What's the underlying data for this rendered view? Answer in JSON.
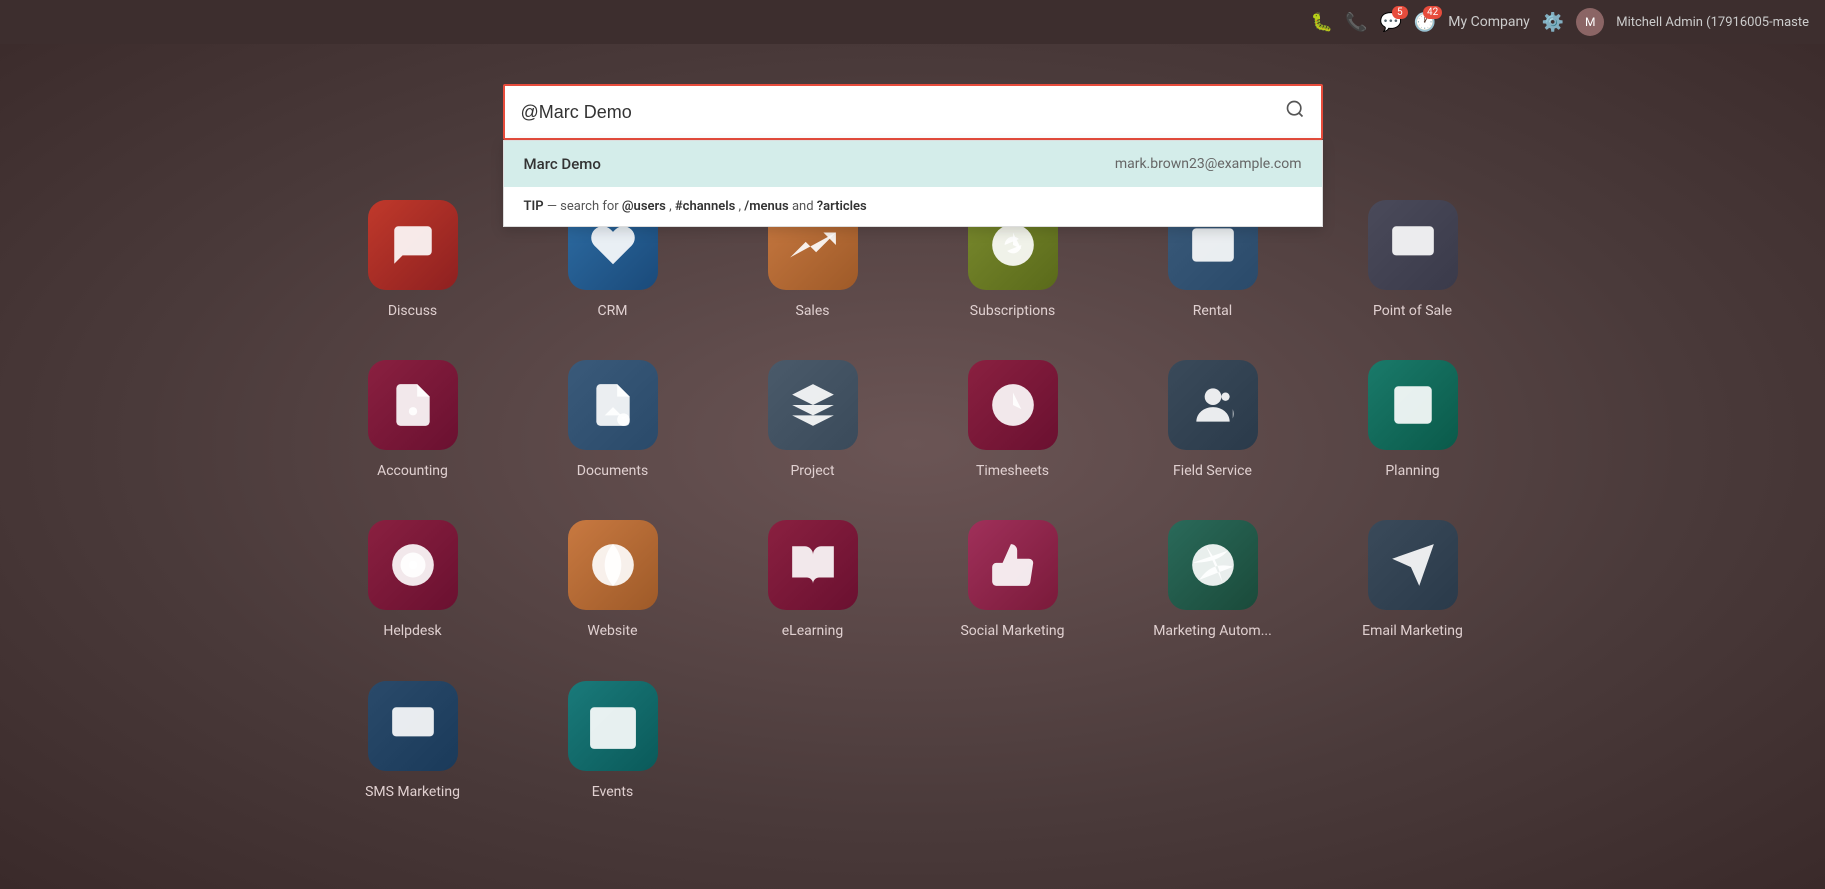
{
  "topbar": {
    "company": "My Company",
    "username": "Mitchell Admin (17916005-maste",
    "chat_badge": "5",
    "activity_badge": "42"
  },
  "search": {
    "value": "@Marc Demo",
    "placeholder": "Search..."
  },
  "dropdown": {
    "result_name": "Marc Demo",
    "result_email": "mark.brown23@example.com",
    "tip_text": " — search for ",
    "tip_users": "@users",
    "tip_channels": "#channels",
    "tip_menus": "/menus",
    "tip_articles": "?articles",
    "tip_label": "TIP",
    "tip_and": " and "
  },
  "apps": [
    {
      "id": "discuss",
      "label": "Discuss",
      "icon_class": "ic-discuss"
    },
    {
      "id": "crm",
      "label": "CRM",
      "icon_class": "ic-crm"
    },
    {
      "id": "sales",
      "label": "Sales",
      "icon_class": "ic-sales"
    },
    {
      "id": "subscriptions",
      "label": "Subscriptions",
      "icon_class": "ic-subscriptions"
    },
    {
      "id": "rental",
      "label": "Rental",
      "icon_class": "ic-rental"
    },
    {
      "id": "pos",
      "label": "Point of Sale",
      "icon_class": "ic-pos"
    },
    {
      "id": "accounting",
      "label": "Accounting",
      "icon_class": "ic-accounting"
    },
    {
      "id": "documents",
      "label": "Documents",
      "icon_class": "ic-documents"
    },
    {
      "id": "project",
      "label": "Project",
      "icon_class": "ic-project"
    },
    {
      "id": "timesheets",
      "label": "Timesheets",
      "icon_class": "ic-timesheets"
    },
    {
      "id": "fieldservice",
      "label": "Field Service",
      "icon_class": "ic-fieldservice"
    },
    {
      "id": "planning",
      "label": "Planning",
      "icon_class": "ic-planning"
    },
    {
      "id": "helpdesk",
      "label": "Helpdesk",
      "icon_class": "ic-helpdesk"
    },
    {
      "id": "website",
      "label": "Website",
      "icon_class": "ic-website"
    },
    {
      "id": "elearning",
      "label": "eLearning",
      "icon_class": "ic-elearning"
    },
    {
      "id": "socialmarketing",
      "label": "Social Marketing",
      "icon_class": "ic-socialmarketing"
    },
    {
      "id": "marketingautom",
      "label": "Marketing Autom...",
      "icon_class": "ic-marketingautom"
    },
    {
      "id": "emailmarketing",
      "label": "Email Marketing",
      "icon_class": "ic-emailmarketing"
    },
    {
      "id": "smsmarketing",
      "label": "SMS Marketing",
      "icon_class": "ic-smsmarketing"
    },
    {
      "id": "events",
      "label": "Events",
      "icon_class": "ic-events"
    }
  ]
}
